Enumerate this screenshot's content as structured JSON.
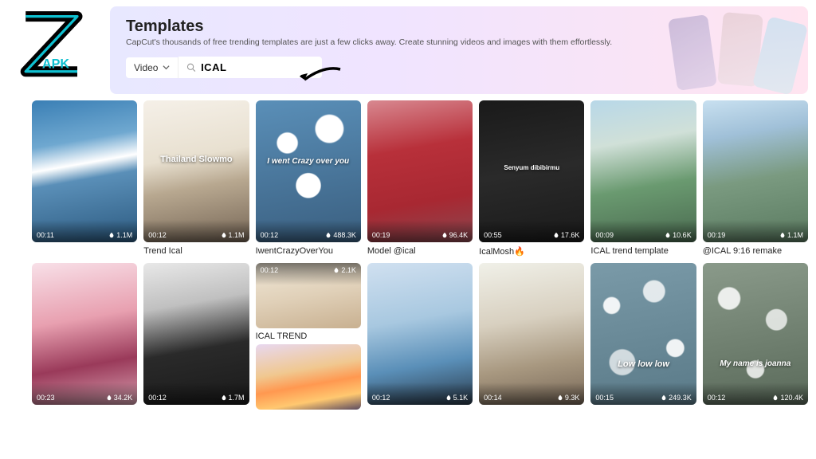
{
  "logo_text": "APK",
  "header": {
    "title": "Templates",
    "subtitle": "CapCut's thousands of free trending templates are just a few clicks away. Create stunning videos and images with them effortlessly."
  },
  "search": {
    "dropdown": "Video",
    "value": "ICAL"
  },
  "row1": [
    {
      "dur": "00:11",
      "uses": "1.1M",
      "title": "",
      "bg": "bg-sky",
      "cap": ""
    },
    {
      "dur": "00:12",
      "uses": "1.1M",
      "title": "Trend Ical",
      "bg": "bg-room",
      "cap": "Thailand Slowmo",
      "capPos": "38%"
    },
    {
      "dur": "00:12",
      "uses": "488.3K",
      "title": "IwentCrazyOverYou",
      "bg": "bg-cloud",
      "cap": "I went Crazy over you",
      "capPos": "40%",
      "capStyle": "font-style:italic;font-size:10px"
    },
    {
      "dur": "00:19",
      "uses": "96.4K",
      "title": "Model @ical",
      "bg": "bg-red",
      "cap": ""
    },
    {
      "dur": "00:55",
      "uses": "17.6K",
      "title": "IcalMosh",
      "flame": true,
      "bg": "bg-dark",
      "cap": "Senyum dibibirmu",
      "capPos": "45%",
      "capStyle": "font-size:8px"
    },
    {
      "dur": "00:09",
      "uses": "10.6K",
      "title": "ICAL trend template",
      "bg": "bg-green",
      "cap": ""
    },
    {
      "dur": "00:19",
      "uses": "1.1M",
      "title": "@ICAL 9:16 remake",
      "bg": "bg-outdoor",
      "cap": ""
    }
  ],
  "row2": [
    {
      "dur": "00:23",
      "uses": "34.2K",
      "bg": "bg-pink"
    },
    {
      "dur": "00:12",
      "uses": "1.7M",
      "bg": "bg-bw"
    },
    {
      "mini": true,
      "miniDur": "00:12",
      "miniUses": "2.1K",
      "miniTitle": "ICAL TREND",
      "bg1": "bg-beige",
      "bg2": "bg-sunset"
    },
    {
      "dur": "00:12",
      "uses": "5.1K",
      "bg": "bg-palm"
    },
    {
      "dur": "00:14",
      "uses": "9.3K",
      "bg": "bg-road"
    },
    {
      "dur": "00:15",
      "uses": "249.3K",
      "bg": "bg-bokeh",
      "cap": "Low low low",
      "capPos": "68%",
      "capStyle": "font-style:italic"
    },
    {
      "dur": "00:12",
      "uses": "120.4K",
      "bg": "bg-bokeh2",
      "cap": "My name is joanna",
      "capPos": "68%",
      "capStyle": "font-style:italic;font-size:10px"
    }
  ]
}
